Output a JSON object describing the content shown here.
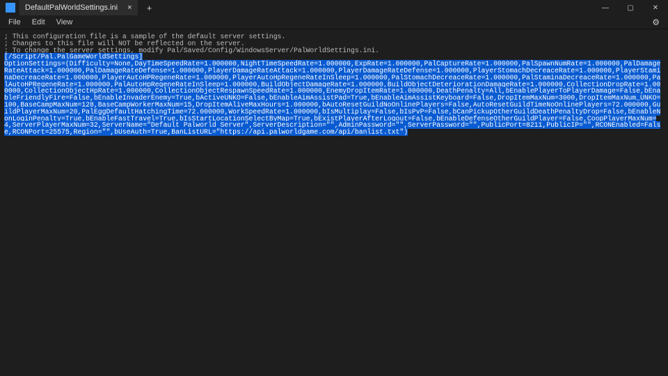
{
  "tab": {
    "title": "DefaultPalWorldSettings.ini",
    "close_glyph": "×",
    "new_glyph": "+"
  },
  "window": {
    "min_glyph": "—",
    "max_glyph": "▢",
    "close_glyph": "✕"
  },
  "menu": {
    "file": "File",
    "edit": "Edit",
    "view": "View",
    "gear_glyph": "⚙"
  },
  "content": {
    "comment1": "; This configuration file is a sample of the default server settings.",
    "comment2": "; Changes to this file will NOT be reflected on the server.",
    "comment3": "; To change the server settings, modify Pal/Saved/Config/WindowsServer/PalWorldSettings.ini.",
    "selected": "[/Script/Pal.PalGameWorldSettings]\nOptionSettings=(Difficulty=None,DayTimeSpeedRate=1.000000,NightTimeSpeedRate=1.000000,ExpRate=1.000000,PalCaptureRate=1.000000,PalSpawnNumRate=1.000000,PalDamageRateAttack=1.000000,PalDamageRateDefense=1.000000,PlayerDamageRateAttack=1.000000,PlayerDamageRateDefense=1.000000,PlayerStomachDecreaceRate=1.000000,PlayerStaminaDecreaceRate=1.000000,PlayerAutoHPRegeneRate=1.000000,PlayerAutoHpRegeneRateInSleep=1.000000,PalStomachDecreaceRate=1.000000,PalStaminaDecreaceRate=1.000000,PalAutoHPRegeneRate=1.000000,PalAutoHpRegeneRateInSleep=1.000000,BuildObjectDamageRate=1.000000,BuildObjectDeteriorationDamageRate=1.000000,CollectionDropRate=1.000000,CollectionObjectHpRate=1.000000,CollectionObjectRespawnSpeedRate=1.000000,EnemyDropItemRate=1.000000,DeathPenalty=All,bEnablePlayerToPlayerDamage=False,bEnableFriendlyFire=False,bEnableInvaderEnemy=True,bActiveUNKO=False,bEnableAimAssistPad=True,bEnableAimAssistKeyboard=False,DropItemMaxNum=3000,DropItemMaxNum_UNKO=100,BaseCampMaxNum=128,BaseCampWorkerMaxNum=15,DropItemAliveMaxHours=1.000000,bAutoResetGuildNoOnlinePlayers=False,AutoResetGuildTimeNoOnlinePlayers=72.000000,GuildPlayerMaxNum=20,PalEggDefaultHatchingTime=72.000000,WorkSpeedRate=1.000000,bIsMultiplay=False,bIsPvP=False,bCanPickupOtherGuildDeathPenaltyDrop=False,bEnableNonLoginPenalty=True,bEnableFastTravel=True,bIsStartLocationSelectByMap=True,bExistPlayerAfterLogout=False,bEnableDefenseOtherGuildPlayer=False,CoopPlayerMaxNum=4,ServerPlayerMaxNum=32,ServerName=\"Default Palworld Server\",ServerDescription=\"\",AdminPassword=\"\",ServerPassword=\"\",PublicPort=8211,PublicIP=\"\",RCONEnabled=False,RCONPort=25575,Region=\"\",bUseAuth=True,BanListURL=\"https://api.palworldgame.com/api/banlist.txt\")"
  }
}
